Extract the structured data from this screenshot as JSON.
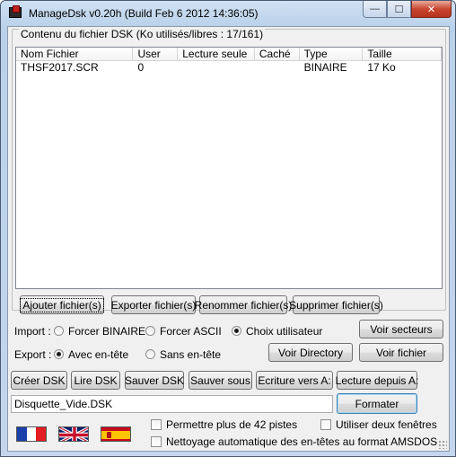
{
  "window": {
    "title": "ManageDsk v0.20h (Build Feb  6 2012 14:36:05)"
  },
  "caption_buttons": {
    "minimize": "—",
    "maximize": "☐",
    "close": "✕"
  },
  "group": {
    "title": "Contenu du fichier DSK (Ko utilisés/libres : 17/161)",
    "columns": [
      "Nom Fichier",
      "User",
      "Lecture seule",
      "Caché",
      "Type",
      "Taille"
    ],
    "rows": [
      {
        "name": "THSF2017.SCR",
        "user": "0",
        "readonly": "",
        "hidden": "",
        "type": "BINAIRE",
        "size": "17 Ko"
      }
    ]
  },
  "file_buttons": {
    "add": "Ajouter fichier(s)",
    "export": "Exporter fichier(s)",
    "rename": "Renommer fichier(s)",
    "delete": "Supprimer fichier(s)"
  },
  "import": {
    "label": "Import :",
    "options": [
      "Forcer BINAIRE",
      "Forcer ASCII",
      "Choix utilisateur"
    ],
    "selected": "Choix utilisateur"
  },
  "export": {
    "label": "Export :",
    "options": [
      "Avec en-tête",
      "Sans en-tête"
    ],
    "selected": "Avec en-tête"
  },
  "view_buttons": {
    "sectors": "Voir secteurs",
    "directory": "Voir Directory",
    "file": "Voir fichier"
  },
  "disk_buttons": {
    "create": "Créer DSK",
    "read": "Lire DSK",
    "save": "Sauver DSK",
    "save_as": "Sauver sous",
    "write_a": "Ecriture vers A:",
    "read_a": "Lecture depuis A:"
  },
  "filename": {
    "value": "Disquette_Vide.DSK"
  },
  "format_button": "Formater",
  "options": {
    "allow_42_tracks": {
      "label": "Permettre plus de 42 pistes",
      "checked": false
    },
    "two_windows": {
      "label": "Utiliser deux fenêtres",
      "checked": false
    },
    "auto_clean_headers": {
      "label": "Nettoyage automatique des en-têtes au format AMSDOS",
      "checked": false
    }
  },
  "languages": [
    "french-flag",
    "uk-flag",
    "spanish-flag"
  ],
  "colors": {
    "accent": "#3c7fb1",
    "close_button": "#c9462f",
    "background": "#f0f0f0"
  }
}
